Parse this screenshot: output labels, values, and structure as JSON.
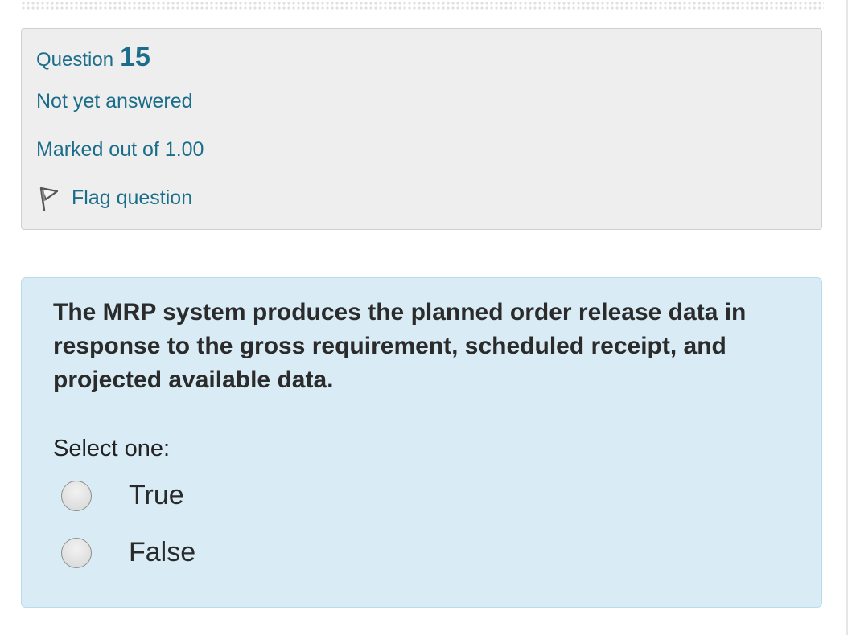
{
  "question_info": {
    "question_word": "Question",
    "question_number": "15",
    "state": "Not yet answered",
    "grade": "Marked out of 1.00",
    "flag_label": "Flag question",
    "flag_icon": "flag-icon"
  },
  "question": {
    "text": "The MRP system produces the planned order release data in response to the gross requirement, scheduled receipt, and projected available data.",
    "prompt": "Select one:",
    "options": [
      {
        "label": "True"
      },
      {
        "label": "False"
      }
    ]
  },
  "colors": {
    "link": "#1b6e8a",
    "info_bg": "#eeeeee",
    "content_bg": "#d9ecf6"
  }
}
